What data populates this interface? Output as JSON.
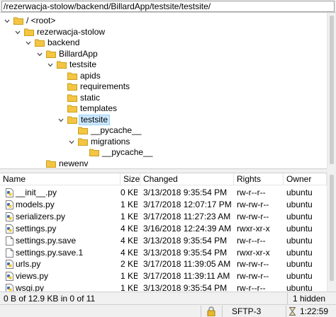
{
  "path": "/rezerwacja-stolow/backend/BillardApp/testsite/testsite/",
  "tree": [
    {
      "label": "/ <root>",
      "expanded": true,
      "selected": false
    },
    {
      "label": "rezerwacja-stolow",
      "expanded": true,
      "selected": false
    },
    {
      "label": "backend",
      "expanded": true,
      "selected": false
    },
    {
      "label": "BillardApp",
      "expanded": true,
      "selected": false
    },
    {
      "label": "testsite",
      "expanded": true,
      "selected": false
    },
    {
      "label": "apids",
      "expanded": null,
      "selected": false
    },
    {
      "label": "requirements",
      "expanded": null,
      "selected": false
    },
    {
      "label": "static",
      "expanded": null,
      "selected": false
    },
    {
      "label": "templates",
      "expanded": null,
      "selected": false
    },
    {
      "label": "testsite",
      "expanded": true,
      "selected": true
    },
    {
      "label": "__pycache__",
      "expanded": null,
      "selected": false
    },
    {
      "label": "migrations",
      "expanded": true,
      "selected": false
    },
    {
      "label": "__pycache__",
      "expanded": null,
      "selected": false
    },
    {
      "label": "newenv",
      "expanded": null,
      "selected": false
    }
  ],
  "columns": {
    "name": "Name",
    "size": "Size",
    "changed": "Changed",
    "rights": "Rights",
    "owner": "Owner"
  },
  "files": [
    {
      "name": "__init__.py",
      "size": "0 KB",
      "changed": "3/13/2018 9:35:54 PM",
      "rights": "rw-r--r--",
      "owner": "ubuntu",
      "icon": "python-file-icon"
    },
    {
      "name": "models.py",
      "size": "1 KB",
      "changed": "3/17/2018 12:07:17 PM",
      "rights": "rw-rw-r--",
      "owner": "ubuntu",
      "icon": "python-file-icon"
    },
    {
      "name": "serializers.py",
      "size": "1 KB",
      "changed": "3/17/2018 11:27:23 AM",
      "rights": "rw-rw-r--",
      "owner": "ubuntu",
      "icon": "python-file-icon"
    },
    {
      "name": "settings.py",
      "size": "4 KB",
      "changed": "3/16/2018 12:24:39 AM",
      "rights": "rwxr-xr-x",
      "owner": "ubuntu",
      "icon": "python-file-icon"
    },
    {
      "name": "settings.py.save",
      "size": "4 KB",
      "changed": "3/13/2018 9:35:54 PM",
      "rights": "rw-r--r--",
      "owner": "ubuntu",
      "icon": "document-icon"
    },
    {
      "name": "settings.py.save.1",
      "size": "4 KB",
      "changed": "3/13/2018 9:35:54 PM",
      "rights": "rwxr-xr-x",
      "owner": "ubuntu",
      "icon": "document-icon"
    },
    {
      "name": "urls.py",
      "size": "2 KB",
      "changed": "3/17/2018 11:39:05 AM",
      "rights": "rw-rw-r--",
      "owner": "ubuntu",
      "icon": "python-file-icon"
    },
    {
      "name": "views.py",
      "size": "1 KB",
      "changed": "3/17/2018 11:39:11 AM",
      "rights": "rw-rw-r--",
      "owner": "ubuntu",
      "icon": "python-file-icon"
    },
    {
      "name": "wsgi.py",
      "size": "1 KB",
      "changed": "3/13/2018 9:35:54 PM",
      "rights": "rw-r--r--",
      "owner": "ubuntu",
      "icon": "python-file-icon"
    }
  ],
  "status": {
    "selection": "0 B of 12.9 KB in 0 of 11",
    "hidden": "1 hidden",
    "protocol": "SFTP-3",
    "time": "1:22:59"
  },
  "colors": {
    "selection_bg": "#cce8ff",
    "folder": "#f4c542",
    "python_blue": "#3a6fb0",
    "python_yellow": "#f2c530"
  }
}
